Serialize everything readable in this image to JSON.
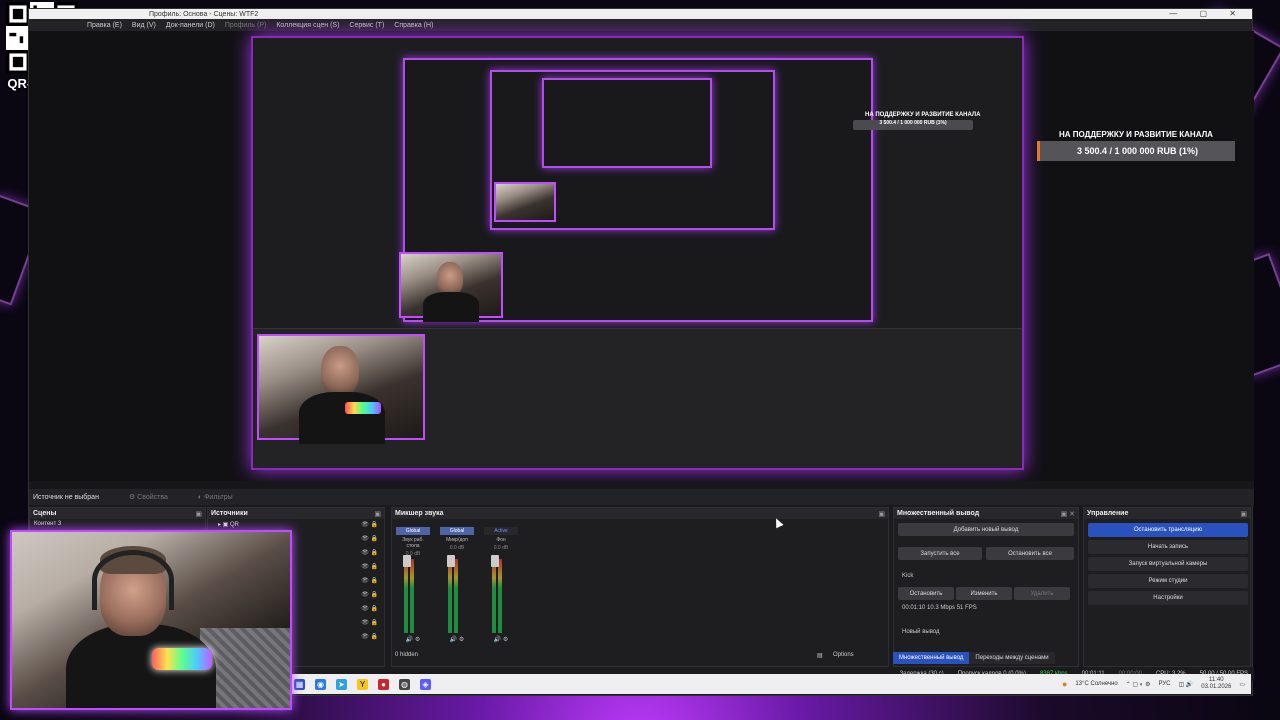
{
  "qr": {
    "label": "QR-ДОНАТ"
  },
  "window": {
    "title": "Профиль: Основа - Сцены: WTF2",
    "controls": "— ▢ ✕"
  },
  "menu": [
    {
      "label": "Правка (E)",
      "enabled": true
    },
    {
      "label": "Вид (V)",
      "enabled": true
    },
    {
      "label": "Док-панели (D)",
      "enabled": true
    },
    {
      "label": "Профиль (P)",
      "enabled": false
    },
    {
      "label": "Коллекция сцен (S)",
      "enabled": true
    },
    {
      "label": "Сервис (T)",
      "enabled": true
    },
    {
      "label": "Справка (H)",
      "enabled": true
    }
  ],
  "goal": {
    "title": "НА ПОДДЕРЖКУ И РАЗВИТИЕ КАНАЛА",
    "progress_text": "3 500.4 / 1 000 000 RUB (1%)",
    "progress_percent": 1
  },
  "source_toolbar": {
    "no_source": "Источник не выбран",
    "properties": "⚙ Свойства",
    "filters": "◐ Фильтры"
  },
  "scenes": {
    "title": "Сцены",
    "items": [
      "Контент 3"
    ]
  },
  "sources": {
    "title": "Источники",
    "items": [
      "QR"
    ]
  },
  "mixer": {
    "title": "Микшер звука",
    "channels": [
      {
        "tag": "Global",
        "name": "Звук раб. стола",
        "db": "0.0 dB"
      },
      {
        "tag": "Global",
        "name": "Микр/доп",
        "db": "0.0 dB"
      },
      {
        "tag": "Active",
        "name": "Фон",
        "db": "0.0 dB"
      }
    ],
    "hidden": "0 hidden",
    "options": "Options"
  },
  "multi_output": {
    "title": "Множественный вывод",
    "add_button": "Добавить новый вывод",
    "start_all": "Запустить все",
    "stop_all": "Остановить все",
    "target_name": "Kick",
    "stop": "Остановить",
    "edit": "Изменить",
    "delete": "Удалить",
    "stats": "00:01:10 10.3 Mbps 51 FPS",
    "new_output": "Новый вывод",
    "tabs": [
      "Множественный вывод",
      "Переходы между сценами"
    ]
  },
  "controls": {
    "title": "Управление",
    "buttons": [
      "Остановить трансляцию",
      "Начать запись",
      "Запуск виртуальной камеры",
      "Режим студии",
      "Настройки"
    ]
  },
  "status": {
    "delay": "Задержка (30 с)",
    "dropped": "Пропуск кадров 0 (0.0%)",
    "bitrate": "8387 kbps",
    "stream_time": "00:01:11",
    "rec_time": "00:00:00",
    "cpu": "CPU: 3.2%",
    "fps": "50.00 / 50.00 FPS"
  },
  "taskbar": {
    "weather": "13°C Солнечно",
    "lang": "РУС",
    "time": "11:40",
    "date": "03.01.2026"
  },
  "colors": {
    "accent_blue": "#2a52be",
    "neon_purple": "#c04cff",
    "goal_orange": "#e07a2e"
  }
}
